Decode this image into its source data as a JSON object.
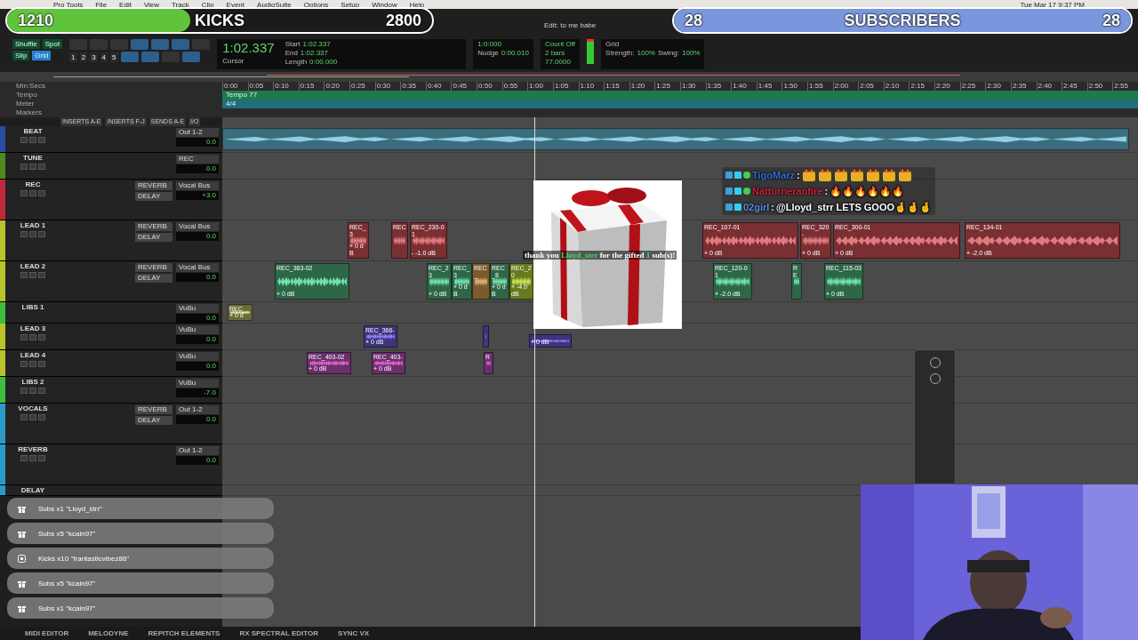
{
  "menu_bar": {
    "items": [
      "Pro Tools",
      "File",
      "Edit",
      "View",
      "Track",
      "Clip",
      "Event",
      "AudioSuite",
      "Options",
      "Setup",
      "Window",
      "Help"
    ],
    "clock": "Tue Mar 17  9:37 PM"
  },
  "goals": [
    {
      "current": "1210",
      "label": "KICKS",
      "target": "2800",
      "level": 0.43,
      "color": "#5fc43c"
    },
    {
      "current": "28",
      "label": "SUBSCRIBERS",
      "target": "28",
      "level": 1,
      "color": "#7a96dc"
    }
  ],
  "toolbar": {
    "title": "Edit: to me babe",
    "modes": [
      {
        "label": "Shuffle",
        "selected": false
      },
      {
        "label": "Spot",
        "selected": false
      },
      {
        "label": "Slip",
        "selected": false
      },
      {
        "label": "Grid",
        "selected": true
      }
    ],
    "zoom_presets": [
      "1",
      "2",
      "3",
      "4",
      "5"
    ],
    "counter": "1:02.337",
    "counter_label": "Cursor",
    "selection": [
      {
        "label": "Start",
        "value": "1:02.337"
      },
      {
        "label": "End",
        "value": "1:02.337"
      },
      {
        "label": "Length",
        "value": "0:00.000"
      }
    ],
    "grid_value": "1:0:000",
    "nudge_label": "Nudge",
    "nudge_value": "0:00.010",
    "count_off": "Count Off",
    "bars": "2 bars",
    "tempo": "77.0000",
    "grid_label": "Grid",
    "strength_label": "Strength:",
    "strength": "100%",
    "swing_label": "Swing:",
    "swing": "100%"
  },
  "rulers": [
    {
      "label": "Min:Secs"
    },
    {
      "label": "Tempo",
      "value": "Tempo 77"
    },
    {
      "label": "Meter",
      "value": "4/4"
    },
    {
      "label": "Markers"
    }
  ],
  "ruler_ticks": [
    "0:00",
    "0:05",
    "0:10",
    "0:15",
    "0:20",
    "0:25",
    "0:30",
    "0:35",
    "0:40",
    "0:45",
    "0:50",
    "0:55",
    "1:00",
    "1:05",
    "1:10",
    "1:15",
    "1:20",
    "1:25",
    "1:30",
    "1:35",
    "1:40",
    "1:45",
    "1:50",
    "1:55",
    "2:00",
    "2:05",
    "2:10",
    "2:15",
    "2:20",
    "2:25",
    "2:30",
    "2:35",
    "2:40",
    "2:45",
    "2:50",
    "2:55"
  ],
  "column_headers": [
    "INSERTS A-E",
    "INSERTS F-J",
    "SENDS A-E",
    "I/O"
  ],
  "tracks": [
    {
      "name": "BEAT",
      "color": "#2a4fa0",
      "output": "Out 1-2",
      "vol": "0.0",
      "clips": [
        {
          "kind": "beat"
        }
      ]
    },
    {
      "name": "TUNE",
      "color": "#4f8a1e",
      "output": "REC",
      "vol": "0.0"
    },
    {
      "name": "REC",
      "color": "#c0283c",
      "output": "Vocal Bus",
      "vol": "+3.0",
      "sends": [
        "REVERB",
        "DELAY"
      ]
    },
    {
      "name": "LEAD 1",
      "color": "#b8c428",
      "output": "Vocal Bus",
      "vol": "0.0",
      "sends": [
        "REVERB",
        "DELAY"
      ],
      "clips": [
        {
          "name": "REC_3",
          "gain": "+ 0 dB",
          "kind": "red"
        },
        {
          "name": "REC",
          "kind": "red"
        },
        {
          "name": "REC_230-01",
          "gain": "- -1.0 dB",
          "kind": "red"
        },
        {
          "name": "REC_107-01",
          "gain": "+ 0 dB",
          "kind": "red"
        },
        {
          "name": "REC_320-",
          "gain": "+ 0 dB",
          "kind": "red"
        },
        {
          "name": "REC_300-01",
          "gain": "+ 0 dB",
          "kind": "red"
        },
        {
          "name": "REC_134-01",
          "gain": "+ -2.0 dB",
          "kind": "red"
        }
      ]
    },
    {
      "name": "LEAD 2",
      "color": "#b8c428",
      "output": "Vocal Bus",
      "vol": "0.0",
      "sends": [
        "REVERB",
        "DELAY"
      ],
      "clips": [
        {
          "name": "REC_363-02",
          "gain": "+ 0 dB",
          "kind": "green"
        },
        {
          "name": "REC_23",
          "gain": "+ 0 dB",
          "kind": "green"
        },
        {
          "name": "REC_3",
          "gain": "+ 0 dB",
          "kind": "green"
        },
        {
          "name": "REC_",
          "kind": "orange"
        },
        {
          "name": "REC_8",
          "gain": "+ 0 dB",
          "kind": "green"
        },
        {
          "name": "REC_20",
          "gain": "+ -4.0 dB",
          "kind": "lime"
        },
        {
          "name": "REC_120-01",
          "gain": "+ -2.0 dB",
          "kind": "green"
        },
        {
          "name": "RE",
          "kind": "green"
        },
        {
          "name": "REC_115-03",
          "gain": "+ 0 dB",
          "kind": "green"
        }
      ]
    },
    {
      "name": "LIBS 1",
      "color": "#3cbf3c",
      "output": "VuBu",
      "vol": "0.0",
      "clips": [
        {
          "name": "REC_",
          "gain": "+ 0 d",
          "kind": "yellow"
        }
      ]
    },
    {
      "name": "LEAD 3",
      "color": "#b8c428",
      "output": "VuBu",
      "vol": "0.0",
      "clips": [
        {
          "name": "REC_366-",
          "gain": "+ 0 dB",
          "kind": "purple"
        },
        {
          "kind": "purple"
        },
        {
          "gain": "+ 0 dB",
          "kind": "purple"
        }
      ]
    },
    {
      "name": "LEAD 4",
      "color": "#b8c428",
      "output": "VuBu",
      "vol": "0.0",
      "clips": [
        {
          "name": "REC_403-02",
          "gain": "+ 0 dB",
          "kind": "magenta"
        },
        {
          "name": "REC_403-",
          "gain": "+ 0 dB",
          "kind": "magenta"
        },
        {
          "name": "R",
          "kind": "magenta"
        }
      ]
    },
    {
      "name": "LIBS 2",
      "color": "#3cbf3c",
      "output": "VuBu",
      "vol": "-7.0"
    },
    {
      "name": "VOCALS",
      "color": "#2a9ac8",
      "output": "Out 1-2",
      "vol": "0.0",
      "sends": [
        "REVERB",
        "DELAY"
      ]
    },
    {
      "name": "REVERB",
      "color": "#2a9ac8",
      "output": "Out 1-2",
      "vol": "0.0"
    },
    {
      "name": "DELAY",
      "color": "#2a9ac8"
    }
  ],
  "gift_message": {
    "before": "thank you",
    "user": "Lloyd_strr",
    "middle": "for the gifted",
    "count": "1",
    "after": "sub(s)!"
  },
  "chat": [
    {
      "user": "TigoMarz",
      "color": "#2d6fd6",
      "separator": ":"
    },
    {
      "user": "Natturneranfire",
      "color": "#d0203c",
      "separator": ":",
      "text": "🔥🔥🔥🔥🔥🔥"
    },
    {
      "user": "02girl",
      "color": "#5b8ee8",
      "separator": ":",
      "text": "@Lloyd_strr LETS GOOO🤞🤞🤞"
    }
  ],
  "alerts": [
    {
      "kind": "gift",
      "text": "Subs x1 \"Lloyd_strr\""
    },
    {
      "kind": "gift",
      "text": "Subs x5 \"kcain97\""
    },
    {
      "kind": "kick",
      "text": "Kicks x10 \"frantasticvibez86\""
    },
    {
      "kind": "gift",
      "text": "Subs x5 \"kcain97\""
    },
    {
      "kind": "gift",
      "text": "Subs x1 \"kcain97\""
    }
  ],
  "bottom_tabs": [
    "MIDI EDITOR",
    "MELODYNE",
    "REPITCH ELEMENTS",
    "RX SPECTRAL EDITOR",
    "SYNC VX"
  ]
}
